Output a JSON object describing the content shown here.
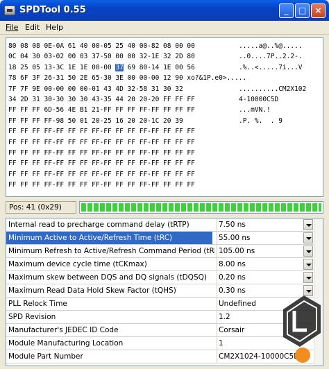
{
  "window": {
    "title": "SPDTool 0.55"
  },
  "menu": {
    "file": "File",
    "edit": "Edit",
    "help": "Help"
  },
  "hex": {
    "rows": [
      {
        "b": "80 08 08 0E-0A 61 40 00-05 25 40 00-82 08 00 00",
        "a": ".....a@..%@....."
      },
      {
        "b": "0C 04 30 03-02 00 03 37-50 00 00 32-1E 32 2D 80",
        "a": "..0....7P..2.2-."
      },
      {
        "b": "18 25 05 13-3C 1E 1E 00-00 ",
        "h": "37",
        "b2": " 69 80-14 1E 00 56",
        "a": ".%..<.....7i...V"
      },
      {
        "b": "78 6F 3F 26-31 50 2E 65-30 3E 00 00-00 12 90 xo?&1P.e0>....."
      },
      {
        "b": "7F 7F 9E 00-00 00 00-01 43 4D 32-58 31 30 32",
        "a": "..........CM2X102"
      },
      {
        "b": "34 2D 31 30-30 30 30 43-35 44 20 20-20 FF FF FF",
        "a": "4-10000C5D"
      },
      {
        "b": "FF FF FF 6D-56 4E B1 21-FF FF FF FF-FF FF FF FF",
        "a": "...mVN.!"
      },
      {
        "b": "FF FF FF FF-98 50 01 20-25 16 20 20-1C 20 39",
        "a": ".P. %.  . 9"
      },
      {
        "b": "FF FF FF FF-FF FF FF FF-FF FF FF FF-FF FF FF FF",
        "a": ""
      },
      {
        "b": "FF FF FF FF-FF FF FF FF-FF FF FF FF-FF FF FF FF",
        "a": ""
      },
      {
        "b": "FF FF FF FF-FF FF FF FF-FF FF FF FF-FF FF FF FF",
        "a": ""
      },
      {
        "b": "FF FF FF FF-FF FF FF FF-FF FF FF FF-FF FF FF FF",
        "a": ""
      },
      {
        "b": "FF FF FF FF-FF FF FF FF-FF FF FF FF-FF FF FF FF",
        "a": ""
      },
      {
        "b": "FF FF FF FF-FF FF FF FF-FF FF FF FF-FF FF FF FF",
        "a": ""
      }
    ]
  },
  "status": {
    "position": "Pos: 41 (0x29)",
    "progress_fraction": 1.0
  },
  "properties": [
    {
      "name": "Internal read to precharge command delay (tRTP)",
      "value": "7.50 ns",
      "dropdown": true
    },
    {
      "name": "Minimum Active to Active/Refresh Time (tRC)",
      "value": "55.00 ns",
      "dropdown": true,
      "selected": true
    },
    {
      "name": "Minimum Refresh to Active/Refresh Command Period (tRFC)",
      "value": "105.00 ns",
      "dropdown": true
    },
    {
      "name": "Maximum device cycle time (tCKmax)",
      "value": "8.00 ns",
      "dropdown": true
    },
    {
      "name": "Maximum skew between DQS and DQ signals (tDQSQ)",
      "value": "0.20 ns",
      "dropdown": true
    },
    {
      "name": "Maximum Read Data Hold Skew Factor (tQHS)",
      "value": "0.30 ns",
      "dropdown": true
    },
    {
      "name": "PLL Relock Time",
      "value": "Undefined",
      "dropdown": false
    },
    {
      "name": "SPD Revision",
      "value": "1.2",
      "dropdown": false
    },
    {
      "name": "Manufacturer's JEDEC ID Code",
      "value": "Corsair",
      "dropdown": false
    },
    {
      "name": "Module Manufacturing Location",
      "value": "1",
      "dropdown": false
    },
    {
      "name": "Module Part Number",
      "value": "CM2X1024-10000C5D",
      "dropdown": false
    }
  ],
  "colors": {
    "selection": "#316ac5",
    "titlebar": "#0a4ad0",
    "progress": "#3bd23b"
  }
}
